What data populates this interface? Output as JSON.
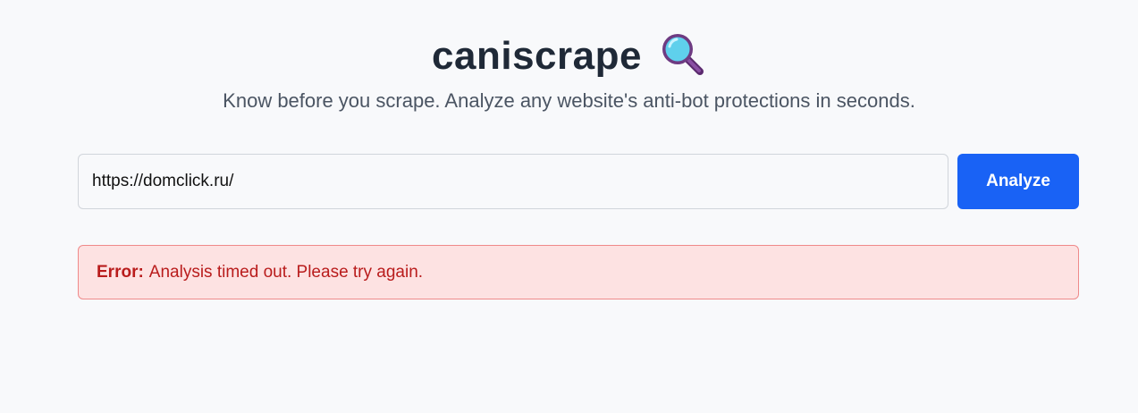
{
  "header": {
    "title": "caniscrape",
    "title_icon": "magnifying-glass-emoji",
    "subtitle": "Know before you scrape. Analyze any website's anti-bot protections in seconds."
  },
  "search": {
    "value": "https://domclick.ru/",
    "button_label": "Analyze"
  },
  "error": {
    "label": "Error:",
    "message": "Analysis timed out. Please try again."
  },
  "colors": {
    "background": "#f8f9fb",
    "title": "#1f2937",
    "subtitle": "#4b5563",
    "button": "#1962f5",
    "error_bg": "#fde2e2",
    "error_border": "#ef8a8a",
    "error_text": "#b91c1c"
  }
}
